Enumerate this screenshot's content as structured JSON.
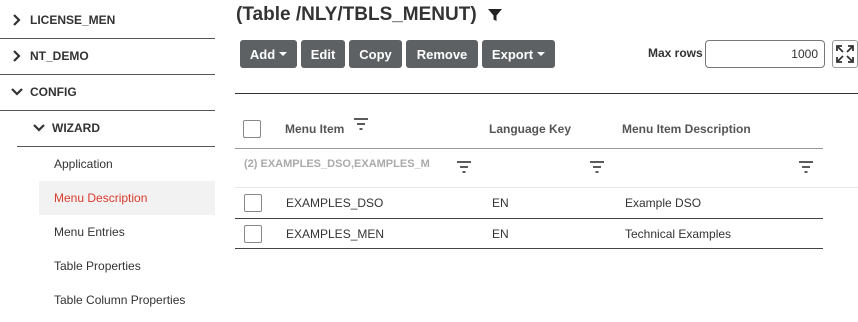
{
  "sidebar": {
    "items": [
      {
        "label": "LICENSE_MEN",
        "state": "collapsed"
      },
      {
        "label": "NT_DEMO",
        "state": "collapsed"
      },
      {
        "label": "CONFIG",
        "state": "expanded"
      },
      {
        "label": "WIZARD",
        "state": "expanded"
      }
    ],
    "sub_items": [
      {
        "label": "Application"
      },
      {
        "label": "Menu Description"
      },
      {
        "label": "Menu Entries"
      },
      {
        "label": "Table Properties"
      },
      {
        "label": "Table Column Properties"
      }
    ],
    "active_sub_item": "Menu Description",
    "active_color": "#d93a2b"
  },
  "header": {
    "title": "(Table /NLY/TBLS_MENUT)"
  },
  "toolbar": {
    "add_label": "Add",
    "edit_label": "Edit",
    "copy_label": "Copy",
    "remove_label": "Remove",
    "export_label": "Export",
    "button_color": "#5d6163"
  },
  "max_rows": {
    "label": "Max rows",
    "value": "1000"
  },
  "table": {
    "columns": [
      "Menu Item",
      "Language Key",
      "Menu Item Description"
    ],
    "filter_text": "(2) EXAMPLES_DSO,EXAMPLES_M",
    "rows": [
      {
        "menu_item": "EXAMPLES_DSO",
        "language_key": "EN",
        "description": "Example DSO"
      },
      {
        "menu_item": "EXAMPLES_MEN",
        "language_key": "EN",
        "description": "Technical Examples"
      }
    ]
  }
}
